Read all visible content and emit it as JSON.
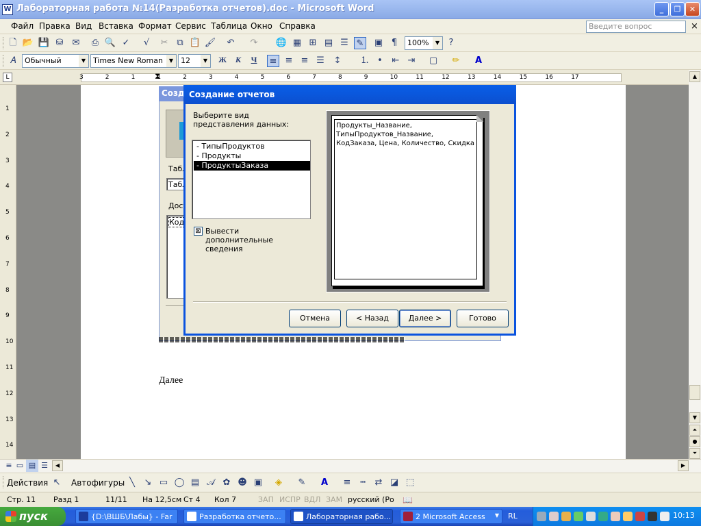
{
  "window": {
    "title": "Лабораторная работа №14(Разработка отчетов).doc - Microsoft Word",
    "icon_letter": "W"
  },
  "window_buttons": {
    "minimize": "_",
    "restore": "❐",
    "close": "✕"
  },
  "menu": {
    "items": [
      "Файл",
      "Правка",
      "Вид",
      "Вставка",
      "Формат",
      "Сервис",
      "Таблица",
      "Окно",
      "Справка"
    ],
    "help_placeholder": "Введите вопрос",
    "close_doc": "×"
  },
  "toolbar_standard": {
    "icons": [
      "new-doc-icon",
      "open-icon",
      "save-icon",
      "permissions-icon",
      "email-icon",
      "print-icon",
      "print-preview-icon",
      "spelling-icon",
      "research-icon",
      "cut-icon",
      "copy-icon",
      "paste-icon",
      "format-painter-icon",
      "undo-icon",
      "redo-icon",
      "hyperlink-icon",
      "tables-borders-icon",
      "insert-table-icon",
      "insert-excel-icon",
      "columns-icon",
      "drawing-icon",
      "document-map-icon",
      "show-formatting-icon",
      "zoom-icon",
      "help-icon"
    ],
    "zoom": "100%"
  },
  "toolbar_formatting": {
    "style": "Обычный",
    "font": "Times New Roman",
    "size": "12",
    "bold": "Ж",
    "italic": "К",
    "underline": "Ч"
  },
  "ruler": {
    "numbers": [
      "3",
      "2",
      "1",
      "1",
      "2",
      "3",
      "4",
      "5",
      "6",
      "7",
      "8",
      "9",
      "10",
      "11",
      "12",
      "13",
      "14",
      "15",
      "16",
      "17"
    ]
  },
  "vruler": {
    "numbers": [
      "1",
      "2",
      "3",
      "4",
      "5",
      "6",
      "7",
      "8",
      "9",
      "10",
      "11",
      "12",
      "13",
      "14"
    ]
  },
  "document": {
    "text": "Далее",
    "back_dialog_title": "Созд",
    "back_label1": "Табл",
    "back_field": "Табл",
    "back_label2": "Дост",
    "back_list_item": "Код"
  },
  "wizard": {
    "title": "Создание отчетов",
    "prompt": "Выберите вид представления данных:",
    "list": [
      "- ТипыПродуктов",
      "- Продукты",
      "- ПродуктыЗаказа"
    ],
    "selected_index": 2,
    "checkbox_label": "Вывести дополнительные сведения",
    "preview_lines": [
      "Продукты_Название,",
      "ТипыПродуктов_Название,",
      "КодЗаказа, Цена, Количество, Скидка"
    ],
    "buttons": {
      "cancel": "Отмена",
      "back": "< Назад",
      "next": "Далее >",
      "finish": "Готово"
    }
  },
  "drawing_toolbar": {
    "actions": "Действия",
    "autoshapes": "Автофигуры"
  },
  "status": {
    "page": "Стр. 11",
    "section": "Разд 1",
    "pages": "11/11",
    "at": "На 12,5см",
    "line": "Ст 4",
    "col": "Кол 7",
    "rec": "ЗАП",
    "trk": "ИСПР",
    "ext": "ВДЛ",
    "ovr": "ЗАМ",
    "lang": "русский (Ро"
  },
  "taskbar": {
    "start": "пуск",
    "tasks": [
      "{D:\\ВШБ\\Лабы} - Far",
      "Разработка отчето...",
      "Лабораторная рабо...",
      "2 Microsoft Access"
    ],
    "lang": "RL",
    "clock": "10:13"
  }
}
